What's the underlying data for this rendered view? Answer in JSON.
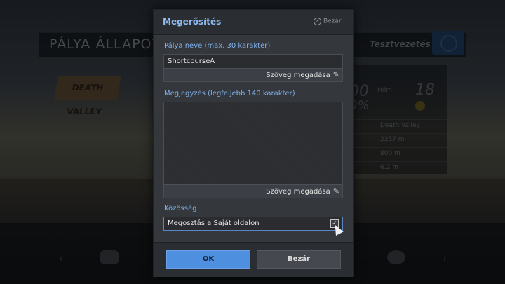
{
  "background": {
    "title": "PÁLYA ÁLLAPOTA",
    "mode": "Tesztvezetés",
    "logo_text": "DEATH VALLEY",
    "location": "Death Valley",
    "stats": [
      "2257 m",
      "800 m",
      "6.2 m"
    ],
    "temperature_prefix": "Hőm.",
    "temperature": "18"
  },
  "dialog": {
    "title": "Megerősítés",
    "close_top_label": "Bezár",
    "name_label": "Pálya neve (max. 30 karakter)",
    "name_value": "ShortcourseA",
    "name_edit_label": "Szöveg megadása",
    "comment_label": "Megjegyzés (legfeljebb 140 karakter)",
    "comment_value": "",
    "comment_edit_label": "Szöveg megadása",
    "community_label": "Közösség",
    "community_value": "Megosztás a Saját oldalon",
    "community_checked": true,
    "ok_label": "OK",
    "cancel_label": "Bezár"
  },
  "colors": {
    "accent": "#4f8fe0",
    "label": "#7fb0ea"
  }
}
